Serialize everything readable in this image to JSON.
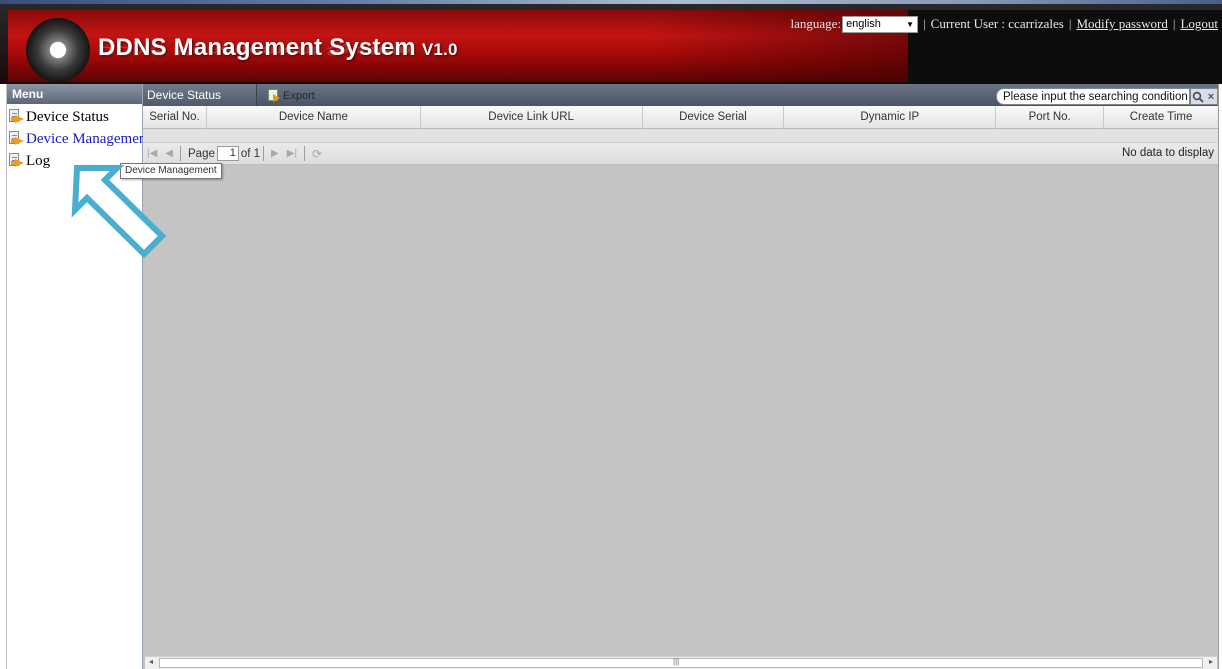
{
  "header": {
    "title": "DDNS Management System",
    "version": "V1.0",
    "language_label": "language:",
    "language_value": "english",
    "current_user": "Current User : ccarrizales",
    "modify_password": "Modify password",
    "logout": "Logout"
  },
  "sidebar": {
    "title": "Menu",
    "items": [
      {
        "label": "Device Status",
        "icon": "document-arrow-icon"
      },
      {
        "label": "Device Management",
        "icon": "document-arrow-icon"
      },
      {
        "label": "Log",
        "icon": "document-arrow-icon"
      }
    ],
    "tooltip": "Device Management"
  },
  "main": {
    "tab": "Device Status",
    "export_label": "Export",
    "search_placeholder": "Please input the searching condition",
    "columns": [
      "Serial No.",
      "Device Name",
      "Device Link URL",
      "Device Serial",
      "Dynamic IP",
      "Port No.",
      "Create Time"
    ],
    "pager": {
      "page_label": "Page",
      "page_value": "1",
      "page_total": "of 1",
      "status": "No data to display"
    }
  },
  "colors": {
    "header_red": "#c41414",
    "menu_header": "#5b6678",
    "annotation_arrow": "#4aaed0",
    "active_link": "#1a1acc"
  }
}
